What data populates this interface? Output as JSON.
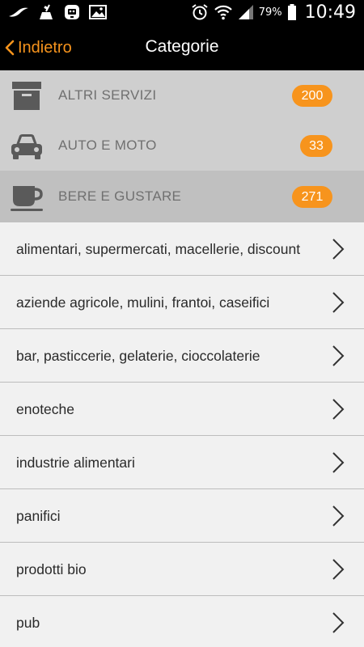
{
  "status_bar": {
    "icons_left": [
      "bird-icon",
      "broom-icon",
      "robot-icon",
      "image-icon"
    ],
    "icons_right": [
      "alarm-icon",
      "wifi-icon",
      "signal-icon",
      "battery-icon"
    ],
    "battery": "79%",
    "time": "10:49"
  },
  "nav": {
    "back_label": "Indietro",
    "title": "Categorie"
  },
  "categories": [
    {
      "label": "ALTRI SERVIZI",
      "count": "200",
      "icon": "archive-box-icon"
    },
    {
      "label": "AUTO E MOTO",
      "count": "33",
      "icon": "car-icon"
    },
    {
      "label": "BERE E GUSTARE",
      "count": "271",
      "icon": "coffee-cup-icon"
    }
  ],
  "subcategories": [
    "alimentari, supermercati, macellerie, discount",
    "aziende agricole, mulini, frantoi, caseifici",
    "bar, pasticcerie, gelaterie, cioccolaterie",
    "enoteche",
    "industrie alimentari",
    "panifici",
    "prodotti bio",
    "pub"
  ],
  "colors": {
    "accent": "#f7941d",
    "header_bg": "#000000",
    "category_bg": "#cfcfcf",
    "category_selected_bg": "#c0c0c0",
    "list_bg": "#f1f1f1"
  }
}
